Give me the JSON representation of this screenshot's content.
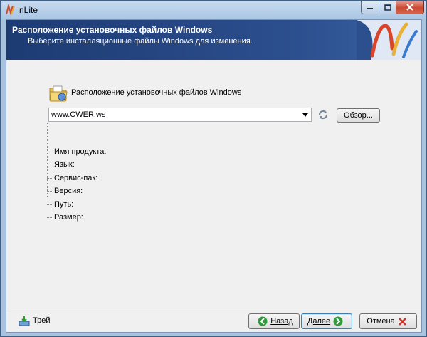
{
  "window": {
    "title": "nLite"
  },
  "banner": {
    "title": "Расположение установочных файлов Windows",
    "subtitle": "Выберите инсталляционные файлы Windows для изменения."
  },
  "section": {
    "label": "Расположение установочных файлов Windows"
  },
  "combo": {
    "value": "www.CWER.ws"
  },
  "buttons": {
    "browse": "Обзор...",
    "back": "Назад",
    "next": "Далее",
    "cancel": "Отмена",
    "tray": "Трей"
  },
  "info": {
    "items": [
      "Имя продукта:",
      "Язык:",
      "Сервис-пак:",
      "Версия:",
      "Путь:",
      "Размер:"
    ]
  },
  "colors": {
    "banner": "#1d3b73",
    "close_button": "#c94a32"
  },
  "icons": [
    "nlite-app-icon",
    "minimize-icon",
    "maximize-icon",
    "close-icon",
    "nlite-logo",
    "folder-icon",
    "dropdown-arrow-icon",
    "refresh-icon",
    "tray-icon",
    "back-arrow-icon",
    "next-arrow-icon",
    "cancel-x-icon"
  ]
}
